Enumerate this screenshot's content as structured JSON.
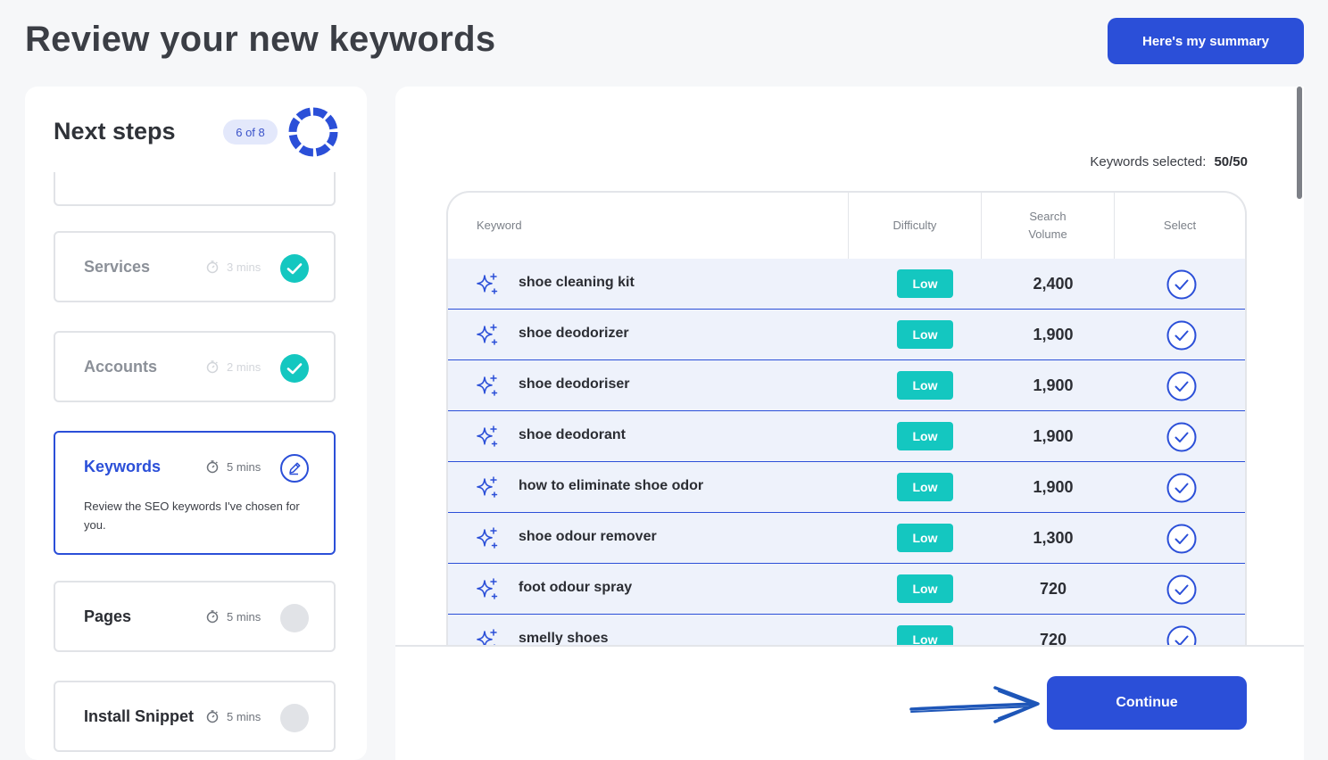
{
  "header": {
    "title": "Review your new keywords",
    "summary_button": "Here's my summary"
  },
  "next_steps": {
    "title": "Next steps",
    "progress_badge": "6 of 8",
    "steps": [
      {
        "name": "Services",
        "time": "3 mins",
        "status": "done"
      },
      {
        "name": "Accounts",
        "time": "2 mins",
        "status": "done"
      },
      {
        "name": "Keywords",
        "time": "5 mins",
        "status": "active",
        "description": "Review the SEO keywords I've chosen for you."
      },
      {
        "name": "Pages",
        "time": "5 mins",
        "status": "pending"
      },
      {
        "name": "Install Snippet",
        "time": "5 mins",
        "status": "pending"
      }
    ]
  },
  "keywords": {
    "selected_label": "Keywords selected:",
    "selected_value": "50/50",
    "columns": [
      "Keyword",
      "Difficulty",
      "Search Volume",
      "Select"
    ],
    "rows": [
      {
        "keyword": "shoe cleaning kit",
        "difficulty": "Low",
        "volume": "2,400"
      },
      {
        "keyword": "shoe deodorizer",
        "difficulty": "Low",
        "volume": "1,900"
      },
      {
        "keyword": "shoe deodoriser",
        "difficulty": "Low",
        "volume": "1,900"
      },
      {
        "keyword": "shoe deodorant",
        "difficulty": "Low",
        "volume": "1,900"
      },
      {
        "keyword": "how to eliminate shoe odor",
        "difficulty": "Low",
        "volume": "1,900"
      },
      {
        "keyword": "shoe odour remover",
        "difficulty": "Low",
        "volume": "1,300"
      },
      {
        "keyword": "foot odour spray",
        "difficulty": "Low",
        "volume": "720"
      },
      {
        "keyword": "smelly shoes",
        "difficulty": "Low",
        "volume": "720"
      }
    ]
  },
  "footer": {
    "continue_button": "Continue"
  },
  "colors": {
    "accent": "#2b4fd8",
    "success": "#14c7c0",
    "row_bg": "#eef2fb",
    "pending": "#e1e3e7"
  }
}
